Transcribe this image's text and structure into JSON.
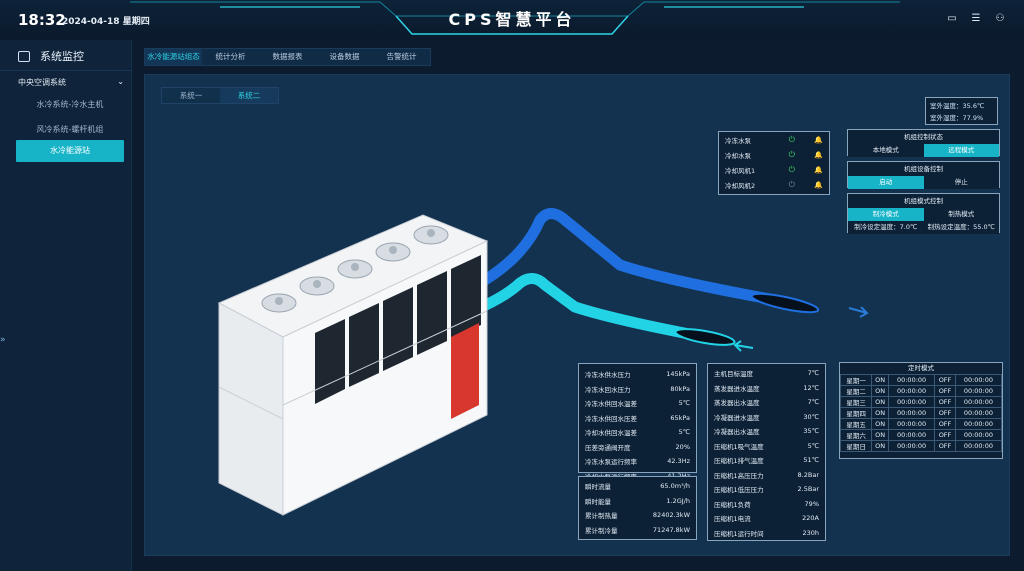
{
  "header": {
    "time": "18:32",
    "date": "2024-04-18 星期四",
    "title": "CPS智慧平台",
    "icons": [
      "monitor-icon",
      "document-icon",
      "users-icon"
    ]
  },
  "sidebar": {
    "title": "系统监控",
    "group": "中央空调系统",
    "items": [
      {
        "label": "水冷系统-冷水主机",
        "active": false
      },
      {
        "label": "风冷系统-螺杆机组",
        "active": false
      },
      {
        "label": "水冷能源站",
        "active": true
      }
    ],
    "handle": "»"
  },
  "tabs": [
    {
      "label": "水冷能源站组态",
      "active": true
    },
    {
      "label": "统计分析",
      "active": false
    },
    {
      "label": "数据报表",
      "active": false
    },
    {
      "label": "设备数据",
      "active": false
    },
    {
      "label": "告警统计",
      "active": false
    }
  ],
  "subtabs": [
    {
      "label": "系统一",
      "active": false
    },
    {
      "label": "系统二",
      "active": true
    }
  ],
  "outdoor": {
    "temp_label": "室外温度：",
    "temp": "35.6℃",
    "hum_label": "室外湿度：",
    "hum": "77.9%"
  },
  "pumps": [
    {
      "name": "冷冻水泵",
      "on": true
    },
    {
      "name": "冷却水泵",
      "on": true
    },
    {
      "name": "冷却风机1",
      "on": true
    },
    {
      "name": "冷却风机2",
      "on": false
    }
  ],
  "control_status": {
    "title": "机组控制状态",
    "options": [
      "本地模式",
      "远程模式"
    ],
    "active": 1
  },
  "device_control": {
    "title": "机组设备控制",
    "options": [
      "启动",
      "停止"
    ],
    "active": 0
  },
  "mode_control": {
    "title": "机组模式控制",
    "options": [
      "制冷模式",
      "制热模式"
    ],
    "active": 0,
    "cool_set": "制冷设定温度：7.0℃",
    "heat_set": "制热设定温度：55.0℃"
  },
  "water_params": [
    {
      "k": "冷冻水供水压力",
      "v": "145kPa"
    },
    {
      "k": "冷冻水回水压力",
      "v": "80kPa"
    },
    {
      "k": "冷冻水供回水温差",
      "v": "5℃"
    },
    {
      "k": "冷冻水供回水压差",
      "v": "65kPa"
    },
    {
      "k": "冷却水供回水温差",
      "v": "5℃"
    },
    {
      "k": "压差旁通阀开度",
      "v": "20%"
    },
    {
      "k": "冷冻水泵运行频率",
      "v": "42.3Hz"
    },
    {
      "k": "冷却水泵运行频率",
      "v": "41.2Hz"
    }
  ],
  "energy_params": [
    {
      "k": "瞬时流量",
      "v": "65.0m³/h"
    },
    {
      "k": "瞬时能量",
      "v": "1.2GJ/h"
    },
    {
      "k": "累计制热量",
      "v": "82402.3kW"
    },
    {
      "k": "累计制冷量",
      "v": "71247.8kW"
    }
  ],
  "unit_params": [
    {
      "k": "主机目标温度",
      "v": "7℃"
    },
    {
      "k": "蒸发器进水温度",
      "v": "12℃"
    },
    {
      "k": "蒸发器出水温度",
      "v": "7℃"
    },
    {
      "k": "冷凝器进水温度",
      "v": "30℃"
    },
    {
      "k": "冷凝器出水温度",
      "v": "35℃"
    },
    {
      "k": "压缩机1吸气温度",
      "v": "5℃"
    },
    {
      "k": "压缩机1排气温度",
      "v": "51℃"
    },
    {
      "k": "压缩机1高压压力",
      "v": "8.2Bar"
    },
    {
      "k": "压缩机1低压压力",
      "v": "2.5Bar"
    },
    {
      "k": "压缩机1负荷",
      "v": "79%"
    },
    {
      "k": "压缩机1电流",
      "v": "220A"
    },
    {
      "k": "压缩机1运行时间",
      "v": "230h"
    }
  ],
  "schedule": {
    "title": "定时模式",
    "rows": [
      {
        "day": "星期一",
        "on": "ON",
        "on_t": "00:00:00",
        "off": "OFF",
        "off_t": "00:00:00"
      },
      {
        "day": "星期二",
        "on": "ON",
        "on_t": "00:00:00",
        "off": "OFF",
        "off_t": "00:00:00"
      },
      {
        "day": "星期三",
        "on": "ON",
        "on_t": "00:00:00",
        "off": "OFF",
        "off_t": "00:00:00"
      },
      {
        "day": "星期四",
        "on": "ON",
        "on_t": "00:00:00",
        "off": "OFF",
        "off_t": "00:00:00"
      },
      {
        "day": "星期五",
        "on": "ON",
        "on_t": "00:00:00",
        "off": "OFF",
        "off_t": "00:00:00"
      },
      {
        "day": "星期六",
        "on": "ON",
        "on_t": "00:00:00",
        "off": "OFF",
        "off_t": "00:00:00"
      },
      {
        "day": "星期日",
        "on": "ON",
        "on_t": "00:00:00",
        "off": "OFF",
        "off_t": "00:00:00"
      }
    ]
  },
  "colors": {
    "accent": "#17b4c8",
    "pipe_blue": "#1f6fe0",
    "pipe_cyan": "#22d3e6",
    "unit_red": "#d8372d"
  }
}
